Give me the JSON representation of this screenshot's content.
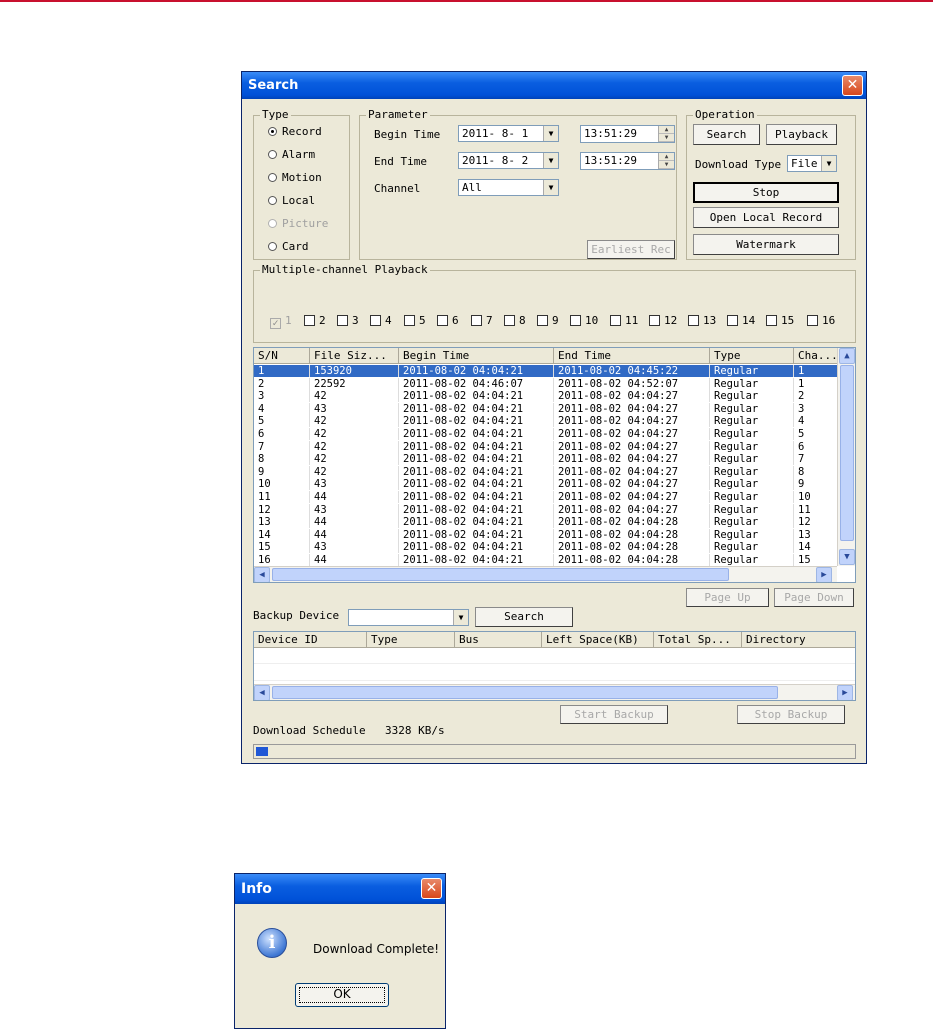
{
  "search_window": {
    "title": "Search",
    "close_glyph": "✕",
    "type_group": {
      "legend": "Type",
      "options": [
        {
          "label": "Record",
          "selected": true,
          "enabled": true
        },
        {
          "label": "Alarm",
          "selected": false,
          "enabled": true
        },
        {
          "label": "Motion",
          "selected": false,
          "enabled": true
        },
        {
          "label": "Local",
          "selected": false,
          "enabled": true
        },
        {
          "label": "Picture",
          "selected": false,
          "enabled": false
        },
        {
          "label": "Card",
          "selected": false,
          "enabled": true
        }
      ]
    },
    "parameter_group": {
      "legend": "Parameter",
      "begin_time_label": "Begin Time",
      "begin_date": "2011- 8- 1",
      "begin_clock": "13:51:29",
      "end_time_label": "End Time",
      "end_date": "2011- 8- 2",
      "end_clock": "13:51:29",
      "channel_label": "Channel",
      "channel_value": "All",
      "earliest_button": "Earliest Rec"
    },
    "operation_group": {
      "legend": "Operation",
      "search_button": "Search",
      "playback_button": "Playback",
      "download_type_label": "Download Type",
      "download_type_value": "File",
      "stop_button": "Stop",
      "open_local_button": "Open Local Record",
      "watermark_button": "Watermark"
    },
    "multi_channel": {
      "legend": "Multiple-channel Playback",
      "channels": [
        "1",
        "2",
        "3",
        "4",
        "5",
        "6",
        "7",
        "8",
        "9",
        "10",
        "11",
        "12",
        "13",
        "14",
        "15",
        "16"
      ]
    },
    "file_list": {
      "columns": [
        "S/N",
        "File Siz...",
        "Begin Time",
        "End Time",
        "Type",
        "Cha..."
      ],
      "rows": [
        [
          "1",
          "153920",
          "2011-08-02 04:04:21",
          "2011-08-02 04:45:22",
          "Regular",
          "1"
        ],
        [
          "2",
          "22592",
          "2011-08-02 04:46:07",
          "2011-08-02 04:52:07",
          "Regular",
          "1"
        ],
        [
          "3",
          "42",
          "2011-08-02 04:04:21",
          "2011-08-02 04:04:27",
          "Regular",
          "2"
        ],
        [
          "4",
          "43",
          "2011-08-02 04:04:21",
          "2011-08-02 04:04:27",
          "Regular",
          "3"
        ],
        [
          "5",
          "42",
          "2011-08-02 04:04:21",
          "2011-08-02 04:04:27",
          "Regular",
          "4"
        ],
        [
          "6",
          "42",
          "2011-08-02 04:04:21",
          "2011-08-02 04:04:27",
          "Regular",
          "5"
        ],
        [
          "7",
          "42",
          "2011-08-02 04:04:21",
          "2011-08-02 04:04:27",
          "Regular",
          "6"
        ],
        [
          "8",
          "42",
          "2011-08-02 04:04:21",
          "2011-08-02 04:04:27",
          "Regular",
          "7"
        ],
        [
          "9",
          "42",
          "2011-08-02 04:04:21",
          "2011-08-02 04:04:27",
          "Regular",
          "8"
        ],
        [
          "10",
          "43",
          "2011-08-02 04:04:21",
          "2011-08-02 04:04:27",
          "Regular",
          "9"
        ],
        [
          "11",
          "44",
          "2011-08-02 04:04:21",
          "2011-08-02 04:04:27",
          "Regular",
          "10"
        ],
        [
          "12",
          "43",
          "2011-08-02 04:04:21",
          "2011-08-02 04:04:27",
          "Regular",
          "11"
        ],
        [
          "13",
          "44",
          "2011-08-02 04:04:21",
          "2011-08-02 04:04:28",
          "Regular",
          "12"
        ],
        [
          "14",
          "44",
          "2011-08-02 04:04:21",
          "2011-08-02 04:04:28",
          "Regular",
          "13"
        ],
        [
          "15",
          "43",
          "2011-08-02 04:04:21",
          "2011-08-02 04:04:28",
          "Regular",
          "14"
        ],
        [
          "16",
          "44",
          "2011-08-02 04:04:21",
          "2011-08-02 04:04:28",
          "Regular",
          "15"
        ]
      ]
    },
    "page_up_button": "Page Up",
    "page_down_button": "Page Down",
    "backup_device_label": "Backup Device",
    "backup_search_button": "Search",
    "device_list": {
      "columns": [
        "Device ID",
        "Type",
        "Bus",
        "Left Space(KB)",
        "Total Sp...",
        "Directory"
      ]
    },
    "start_backup_button": "Start Backup",
    "stop_backup_button": "Stop Backup",
    "download_schedule_label": "Download Schedule",
    "download_rate": "3328 KB/s",
    "progress_fraction": 0.02
  },
  "info_dialog": {
    "title": "Info",
    "close_glyph": "✕",
    "icon_glyph": "i",
    "message": "Download Complete!",
    "ok_button": "OK"
  }
}
